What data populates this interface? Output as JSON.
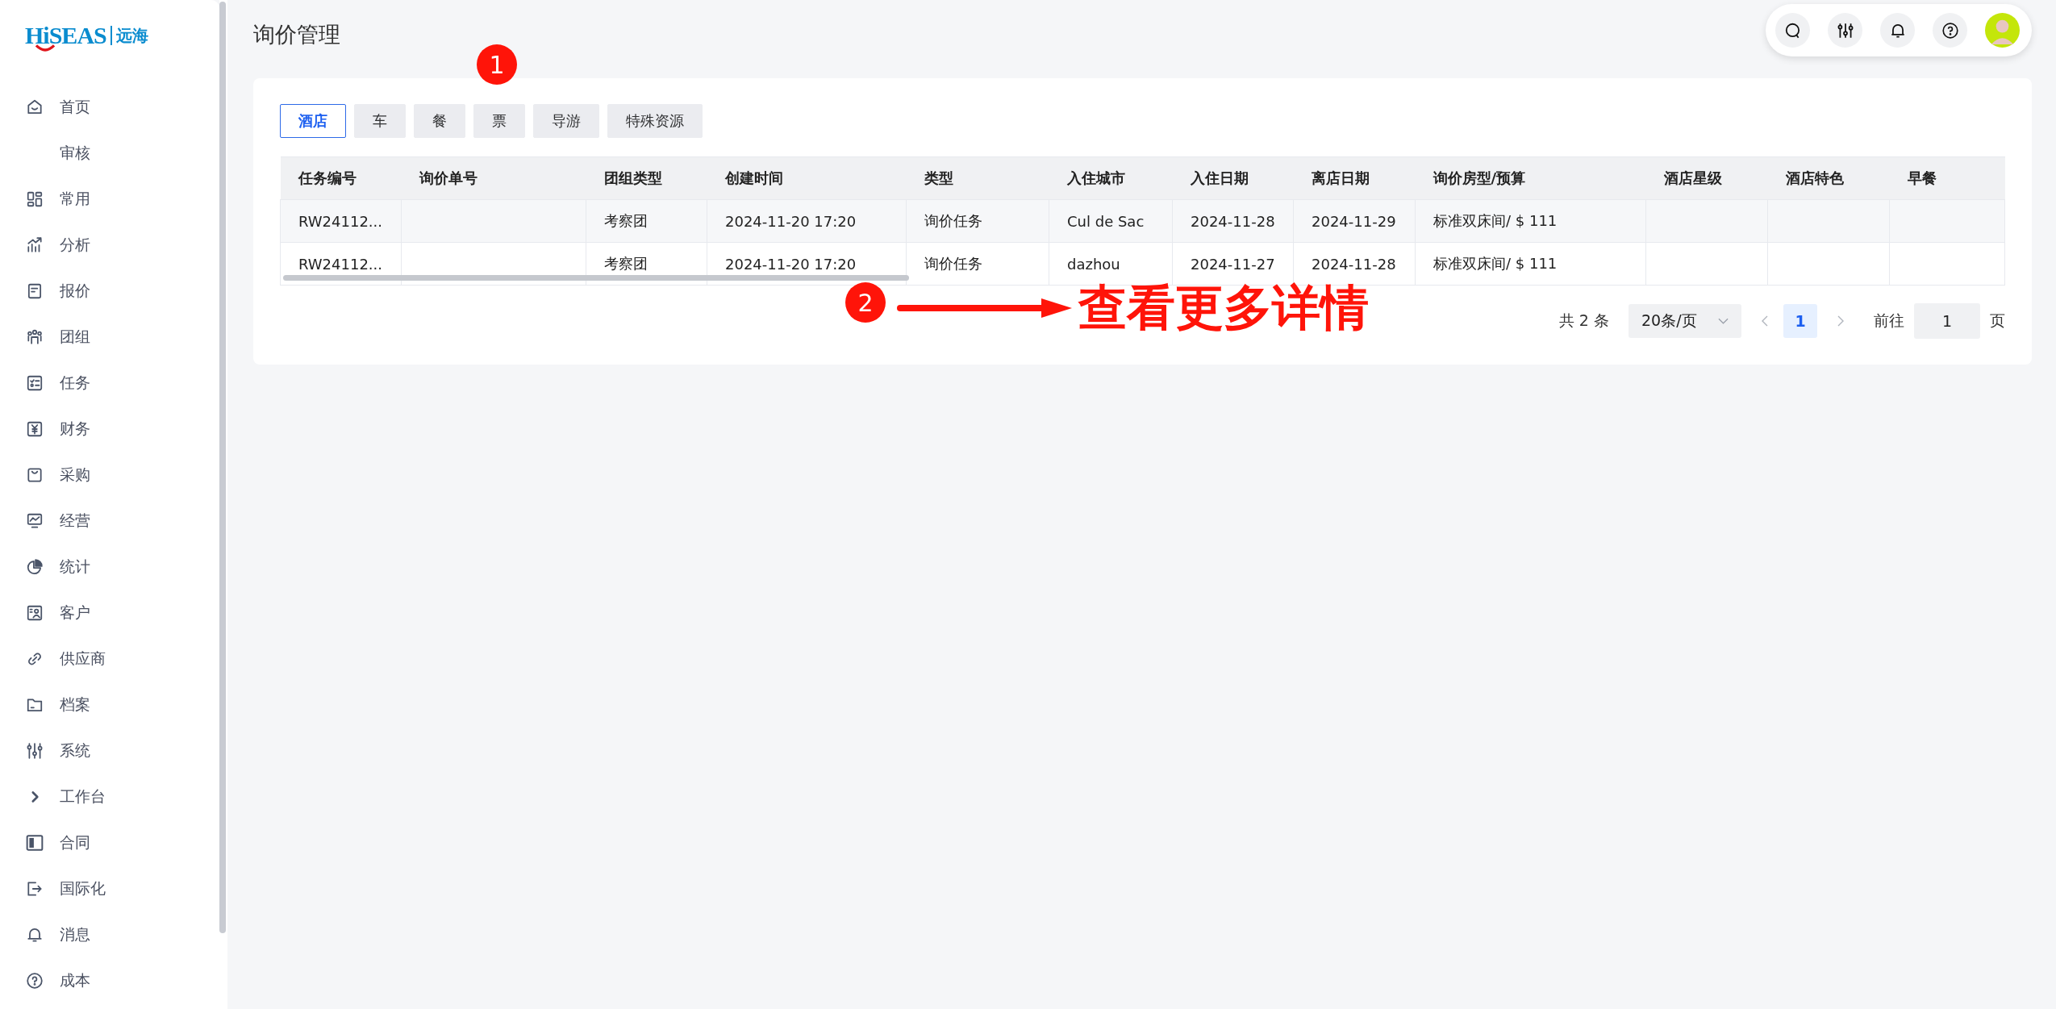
{
  "logo": {
    "brand_start": "H",
    "brand_mark": "i",
    "brand_end": "SEAS",
    "name": "远海"
  },
  "sidebar": {
    "items": [
      {
        "label": "首页"
      },
      {
        "label": "审核"
      },
      {
        "label": "常用"
      },
      {
        "label": "分析"
      },
      {
        "label": "报价"
      },
      {
        "label": "团组"
      },
      {
        "label": "任务"
      },
      {
        "label": "财务"
      },
      {
        "label": "采购"
      },
      {
        "label": "经营"
      },
      {
        "label": "统计"
      },
      {
        "label": "客户"
      },
      {
        "label": "供应商"
      },
      {
        "label": "档案"
      },
      {
        "label": "系统"
      },
      {
        "label": "工作台"
      },
      {
        "label": "合同"
      },
      {
        "label": "国际化"
      },
      {
        "label": "消息"
      },
      {
        "label": "成本"
      }
    ]
  },
  "page_title": "询价管理",
  "tabs": [
    {
      "label": "酒店",
      "selected": true
    },
    {
      "label": "车",
      "selected": false
    },
    {
      "label": "餐",
      "selected": false
    },
    {
      "label": "票",
      "selected": false
    },
    {
      "label": "导游",
      "selected": false
    },
    {
      "label": "特殊资源",
      "selected": false
    }
  ],
  "table": {
    "columns": [
      "任务编号",
      "询价单号",
      "团组类型",
      "创建时间",
      "类型",
      "入住城市",
      "入住日期",
      "离店日期",
      "询价房型/预算",
      "酒店星级",
      "酒店特色",
      "早餐"
    ],
    "rows": [
      [
        "RW24112...",
        null,
        "考察团",
        "2024-11-20 17:20",
        "询价任务",
        "Cul de Sac",
        "2024-11-28",
        "2024-11-29",
        "标准双床间/ $ 111",
        null,
        null,
        null
      ],
      [
        "RW24112...",
        null,
        "考察团",
        "2024-11-20 17:20",
        "询价任务",
        "dazhou",
        "2024-11-27",
        "2024-11-28",
        "标准双床间/ $ 111",
        null,
        null,
        null
      ]
    ]
  },
  "pagination": {
    "total": "共 2 条",
    "page_size": "20条/页",
    "pages": [
      {
        "label": "1",
        "selected": true
      }
    ],
    "goto_label": "前往",
    "goto_value": "1",
    "page_unit": "页"
  },
  "annotations": [
    {
      "kind": "badge",
      "label": "1"
    },
    {
      "kind": "callout",
      "label": "2",
      "text": "查看更多详情"
    }
  ]
}
